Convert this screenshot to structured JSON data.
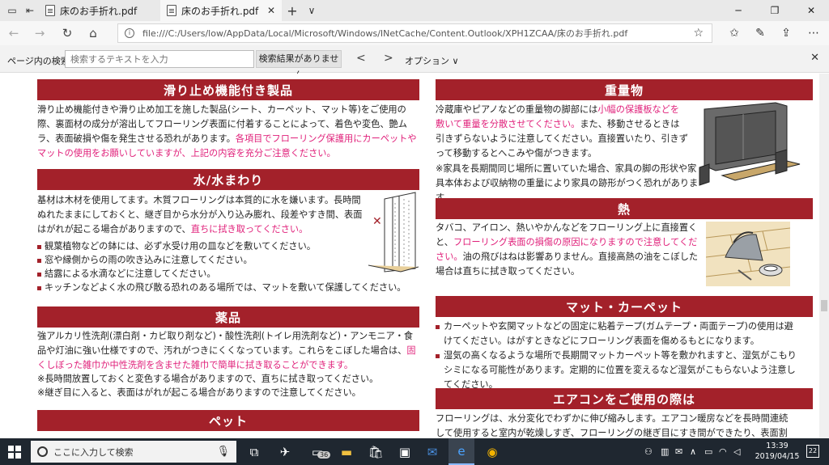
{
  "tabs": [
    {
      "title": "床のお手折れ.pdf"
    },
    {
      "title": "床のお手折れ.pdf"
    }
  ],
  "address": {
    "url": "file:///C:/Users/low/AppData/Local/Microsoft/Windows/INetCache/Content.Outlook/XPH1ZCAA/床のお手折れ.pdf"
  },
  "find": {
    "label": "ページ内の検索",
    "placeholder": "検索するテキストを入力",
    "status": "検索結果がありません",
    "options": "オプション ∨"
  },
  "left": {
    "slip": {
      "title": "滑り止め機能付き製品",
      "text": "滑り止め機能付きや滑り止め加工を施した製品(シート、カーペット、マット等)をご使用の際、裏面材の成分が溶出してフローリング表面に付着することによって、着色や変色、艶ムラ、表面破損や傷を発生させる恐れがあります。",
      "warn": "各項目でフローリング保護用にカーペットやマットの使用をお願いしていますが、上記の内容を充分ご注意ください。"
    },
    "water": {
      "title": "水/水まわり",
      "text": "基材は木材を使用してます。木質フローリングは本質的に水を嫌います。長時間ぬれたままにしておくと、継ぎ目から水分が入り込み膨れ、段差やすき間、表面はがれが起こる場合がありますので、",
      "warn": "直ちに拭き取ってください。",
      "bullets": [
        "観葉植物などの鉢には、必ず水受け用の皿などを敷いてください。",
        "窓や縁側からの雨の吹き込みに注意してください。",
        "結露による水滴などに注意してください。",
        "キッチンなどよく水の飛び散る恐れのある場所では、マットを敷いて保護してください。"
      ]
    },
    "chem": {
      "title": "薬品",
      "text": "強アルカリ性洗剤(漂白剤・カビ取り剤など)・酸性洗剤(トイレ用洗剤など)・アンモニア・食品や灯油に強い仕様ですので、汚れがつきにくくなっています。これらをこぼした場合は、",
      "warn": "固くしぼった雑巾か中性洗剤を含ませた雑巾で簡単に拭き取ることができます。",
      "note1": "※長時間放置しておくと変色する場合がありますので、直ちに拭き取ってください。",
      "note2": "※継ぎ目に入ると、表面はがれが起こる場合がありますので注意してください。"
    },
    "pet": {
      "title": "ペット"
    }
  },
  "right": {
    "heavy": {
      "title": "重量物",
      "text1": "冷蔵庫やピアノなどの重量物の脚部には",
      "warn": "小幅の保護板などを敷いて重量を分散させてください。",
      "text2": "また、移動させるときは引きずらないように注意してください。直接置いたり、引きずって移動するとへこみや傷がつきます。",
      "note": "※家具を長期間同じ場所に置いていた場合、家具の脚の形状や家具本体および収納物の重量により家具の跡形がつく恐れがあります。"
    },
    "heat": {
      "title": "熱",
      "text1": "タバコ、アイロン、熱いやかんなどをフローリング上に直接置くと、",
      "warn": "フローリング表面の損傷の原因になりますので注意してください。",
      "text2": "油の飛びはねは影響ありません。直接高熱の油をこぼした場合は直ちに拭き取ってください。"
    },
    "mat": {
      "title": "マット・カーペット",
      "bullets": [
        "カーペットや玄関マットなどの固定に粘着テープ(ガムテープ・両面テープ)の使用は避けてください。はがすときなどにフローリング表面を傷めるもとになります。",
        "湿気の高くなるような場所で長期間マットカーペット等を敷かれますと、湿気がこもりシミになる可能性があります。定期的に位置を変えるなど湿気がこもらないよう注意してください。"
      ]
    },
    "aircon": {
      "title": "エアコンをご使用の際は",
      "text": "フローリングは、水分変化でわずかに伸び縮みします。エアコン暖房などを長時間連続して使用すると室内が乾燥しすぎ、フローリングの継ぎ目にすき間ができたり、表面割れを生じ"
    }
  },
  "taskbar": {
    "search_placeholder": "ここに入力して検索",
    "badge_count": "36",
    "time": "13:39",
    "date": "2019/04/15",
    "notif_count": "22"
  }
}
